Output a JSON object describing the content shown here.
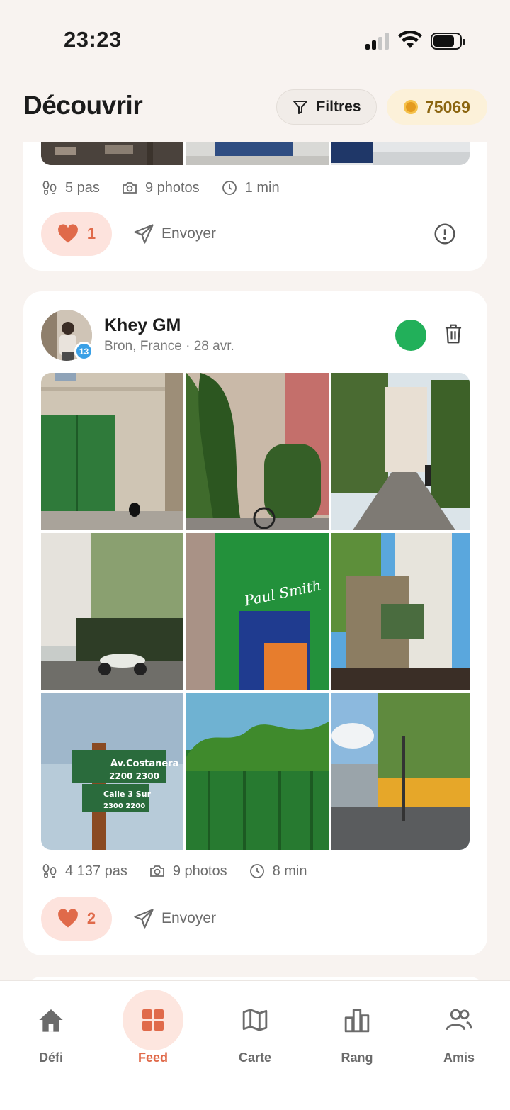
{
  "status_bar": {
    "time": "23:23"
  },
  "header": {
    "title": "Découvrir",
    "filter_label": "Filtres",
    "coins": "75069"
  },
  "posts": [
    {
      "steps": "5 pas",
      "photos": "9 photos",
      "duration": "1 min",
      "likes": "1",
      "send_label": "Envoyer"
    },
    {
      "user_name": "Khey GM",
      "level": "13",
      "meta": "Bron, France · 28 avr.",
      "status_color": "#22b05a",
      "steps": "4 137 pas",
      "photos": "9 photos",
      "duration": "8 min",
      "likes": "2",
      "send_label": "Envoyer"
    }
  ],
  "nav": [
    {
      "label": "Défi",
      "icon": "home-icon",
      "active": false
    },
    {
      "label": "Feed",
      "icon": "grid-icon",
      "active": true
    },
    {
      "label": "Carte",
      "icon": "map-icon",
      "active": false
    },
    {
      "label": "Rang",
      "icon": "bar-chart-icon",
      "active": false
    },
    {
      "label": "Amis",
      "icon": "friends-icon",
      "active": false
    }
  ],
  "colors": {
    "accent": "#e06a4a",
    "like_bg": "#fde3dd",
    "coin_text": "#8b6510"
  }
}
